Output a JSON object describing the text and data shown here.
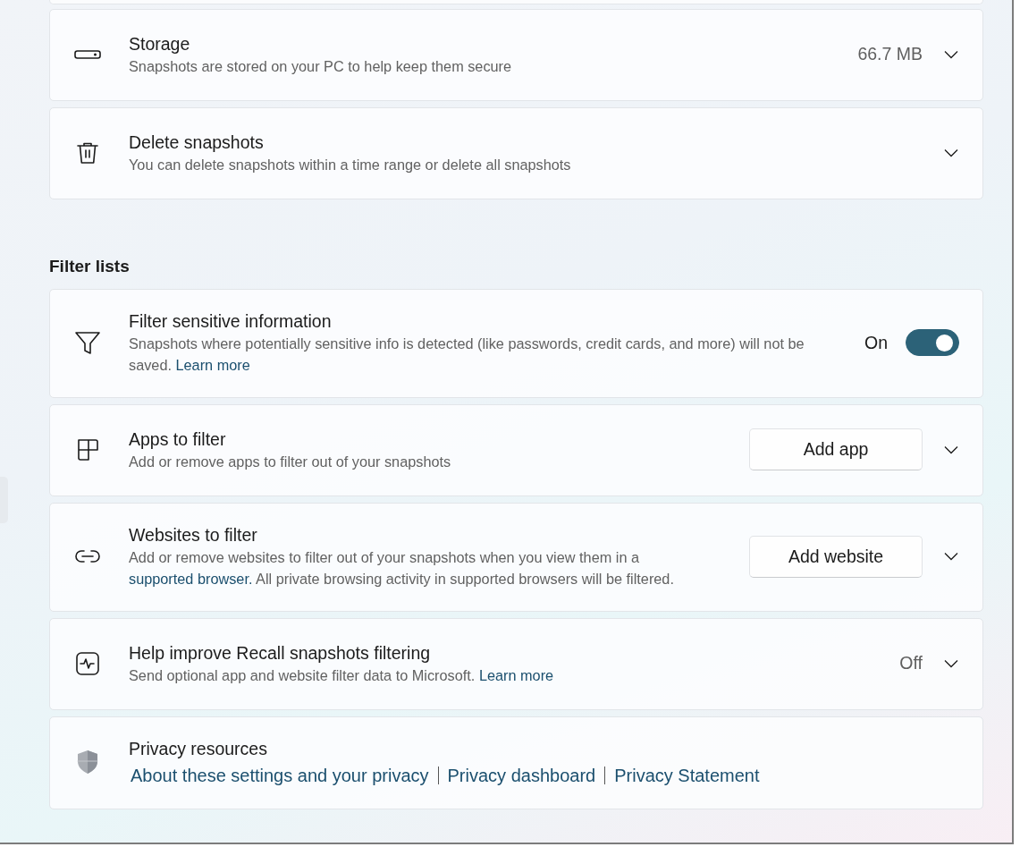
{
  "sections": [
    {
      "cards": [
        {
          "title": "Storage",
          "description": [
            {
              "kind": "text",
              "text": "Snapshots are stored on your PC to help keep them secure"
            }
          ],
          "value": "66.7 MB",
          "expandable": true
        },
        {
          "title": "Delete snapshots",
          "description": [
            {
              "kind": "text",
              "text": "You can delete snapshots within a time range or delete all snapshots"
            }
          ],
          "expandable": true
        }
      ]
    },
    {
      "heading": "Filter lists",
      "cards": [
        {
          "title": "Filter sensitive information",
          "description": [
            {
              "kind": "text",
              "text": "Snapshots where potentially sensitive info is detected (like passwords, credit cards, and more) will not be saved. "
            },
            {
              "kind": "link",
              "text": "Learn more"
            }
          ],
          "toggle": {
            "label": "On",
            "on": true
          },
          "expandable": false
        },
        {
          "title": "Apps to filter",
          "description": [
            {
              "kind": "text",
              "text": "Add or remove apps to filter out of your snapshots"
            }
          ],
          "button": "Add app",
          "expandable": true
        },
        {
          "title": "Websites to filter",
          "description": [
            {
              "kind": "text",
              "text": "Add or remove websites to filter out of your snapshots when you view them in a "
            },
            {
              "kind": "link",
              "text": "supported browser."
            },
            {
              "kind": "text",
              "text": " All private browsing activity in supported browsers will be filtered."
            }
          ],
          "button": "Add website",
          "expandable": true
        },
        {
          "title": "Help improve Recall snapshots filtering",
          "description": [
            {
              "kind": "text",
              "text": "Send optional app and website filter data to Microsoft. "
            },
            {
              "kind": "link",
              "text": "Learn more"
            }
          ],
          "value": "Off",
          "expandable": true
        },
        {
          "title": "Privacy resources",
          "links": [
            "About these settings and your privacy",
            "Privacy dashboard",
            "Privacy Statement"
          ],
          "expandable": false
        }
      ]
    }
  ]
}
